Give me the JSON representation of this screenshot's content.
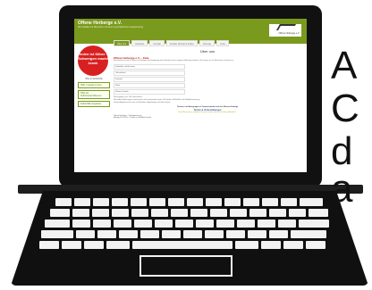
{
  "site": {
    "title": "Offene Herberge e.V.",
    "subtitle": "Die Initiative für Menschen mit einer psychiatrischen Ausgrenzung",
    "logo_text": "Offene Herberge e.V.",
    "nav": [
      "Über uns",
      "Aktuelles",
      "Kontakt",
      "Soziale Netzwerk Seiten",
      "Sitemap",
      "Links"
    ],
    "badge_text": "Reden ist Silber – Schweigen macht krank",
    "sidebar_title": "Hilfe & Selbsthilfe",
    "sidebar_links": [
      "Hilfe in akuten Krisen",
      "Hilfe bei Selbstwertproblemen",
      "Selbsthilfe-Angebote"
    ],
    "main_title": "Über uns",
    "heading": "Offene Herberge e.V. – Ziele",
    "intro": "Die Initiative ist seit 20 Jahren in Stuttgart und Umgebung aktiv. Mitarbeit ist aus eigener Erfahrung motiviert. Wir setzen uns für Menschen in Krisen ein.",
    "list_items": [
      "Selbsthilfe und Beratung",
      "Öffentlichkeit",
      "Kontakte",
      "Recht",
      "Weitere Projekte"
    ],
    "heading2": "Wir begegnen uns. Wir unterstützen.",
    "para2": "Wir wollen Erfahrungen austauschen und voneinander lernen. Wir fördern Selbsthilfe und Selbstbestimmung.",
    "para3": "Dieses Angebot richtet sich an Betroffene, Angehörige und Interessierte.",
    "section_title": "Termine- und Anregungen in Zusammenarbeit mit der Offenen Herberge",
    "section_link": "Termin & Veranstaltungen",
    "yellow_text": "Eine Übersicht zu aktuellen Terminen finden Sie auf der Seite „Aktuelles“.",
    "table_rows": [
      "Offene Herberge · Telefonberatung",
      "Montag 18–20 Uhr · Treffen in der Alten Kanzlei"
    ]
  },
  "side_text": [
    "A",
    "C",
    "d",
    "a"
  ]
}
